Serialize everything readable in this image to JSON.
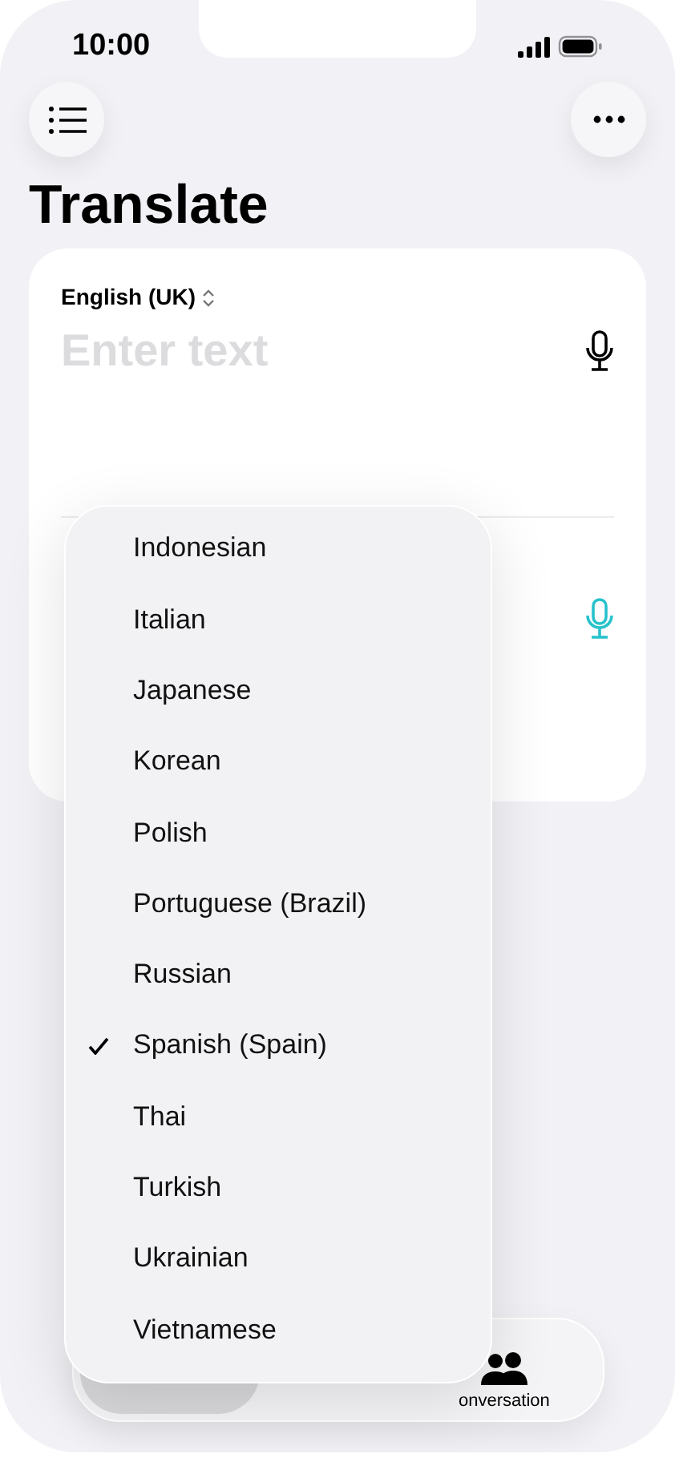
{
  "status_bar": {
    "time": "10:00"
  },
  "title": "Translate",
  "source": {
    "language": "English (UK)",
    "placeholder": "Enter text"
  },
  "language_menu": [
    {
      "label": "Indonesian",
      "selected": false
    },
    {
      "label": "Italian",
      "selected": false
    },
    {
      "label": "Japanese",
      "selected": false
    },
    {
      "label": "Korean",
      "selected": false
    },
    {
      "label": "Polish",
      "selected": false
    },
    {
      "label": "Portuguese (Brazil)",
      "selected": false
    },
    {
      "label": "Russian",
      "selected": false
    },
    {
      "label": "Spanish (Spain)",
      "selected": true
    },
    {
      "label": "Thai",
      "selected": false
    },
    {
      "label": "Turkish",
      "selected": false
    },
    {
      "label": "Ukrainian",
      "selected": false
    },
    {
      "label": "Vietnamese",
      "selected": false
    }
  ],
  "tab_bar": [
    {
      "label": "onversation",
      "selected": false
    }
  ]
}
